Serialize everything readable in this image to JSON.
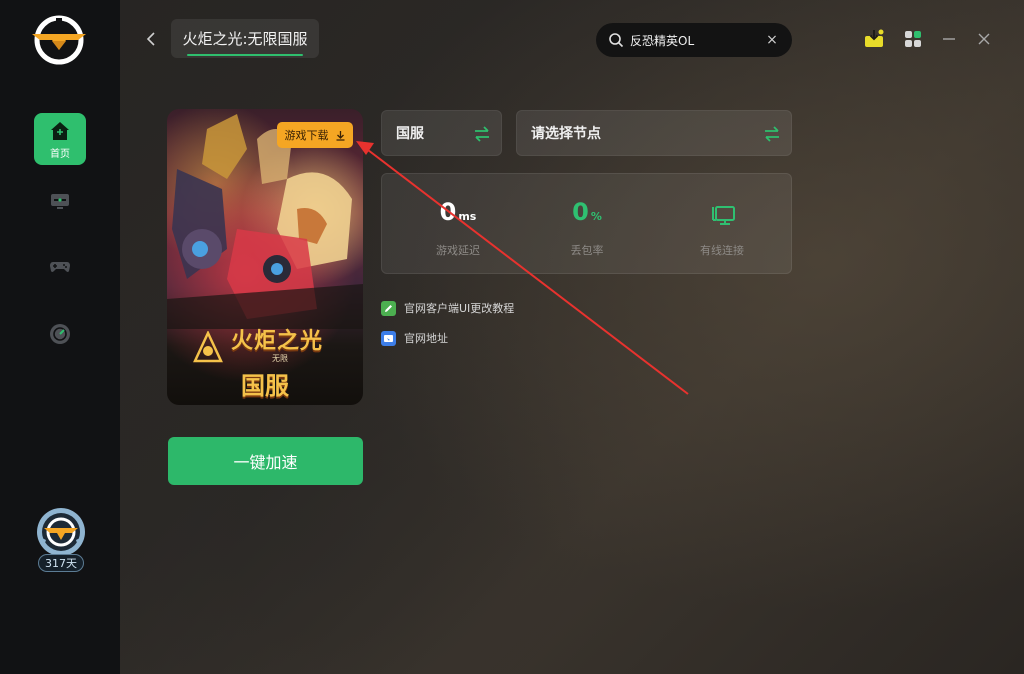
{
  "sidebar": {
    "items": [
      {
        "name": "home",
        "label": "首页",
        "active": true,
        "icon": "home-icon"
      },
      {
        "name": "monitor",
        "label": "",
        "active": false,
        "icon": "monitor-icon"
      },
      {
        "name": "gamepad",
        "label": "",
        "active": false,
        "icon": "gamepad-icon"
      },
      {
        "name": "speed",
        "label": "",
        "active": false,
        "icon": "speedometer-icon"
      }
    ],
    "vip_days": "317天"
  },
  "header": {
    "game_title": "火炬之光:无限国服",
    "search_value": "反恐精英OL",
    "search_clear": "×"
  },
  "cover": {
    "download_label": "游戏下载",
    "logo_title": "火炬之光",
    "logo_subtitle": "无限",
    "logo_region": "国服"
  },
  "selectors": {
    "region": "国服",
    "node": "请选择节点"
  },
  "stats": {
    "latency": {
      "value": "0",
      "unit": "ms",
      "label": "游戏延迟"
    },
    "packet_loss": {
      "value": "0",
      "unit": "%",
      "label": "丢包率"
    },
    "connection": {
      "label": "有线连接"
    }
  },
  "links": [
    {
      "label": "官网客户端UI更改教程",
      "icon": "edit-icon"
    },
    {
      "label": "官网地址",
      "icon": "browser-icon"
    }
  ],
  "actions": {
    "start_label": "一键加速"
  },
  "colors": {
    "accent": "#2fbf6e",
    "download": "#f5a623",
    "annotation": "#e8322e"
  }
}
